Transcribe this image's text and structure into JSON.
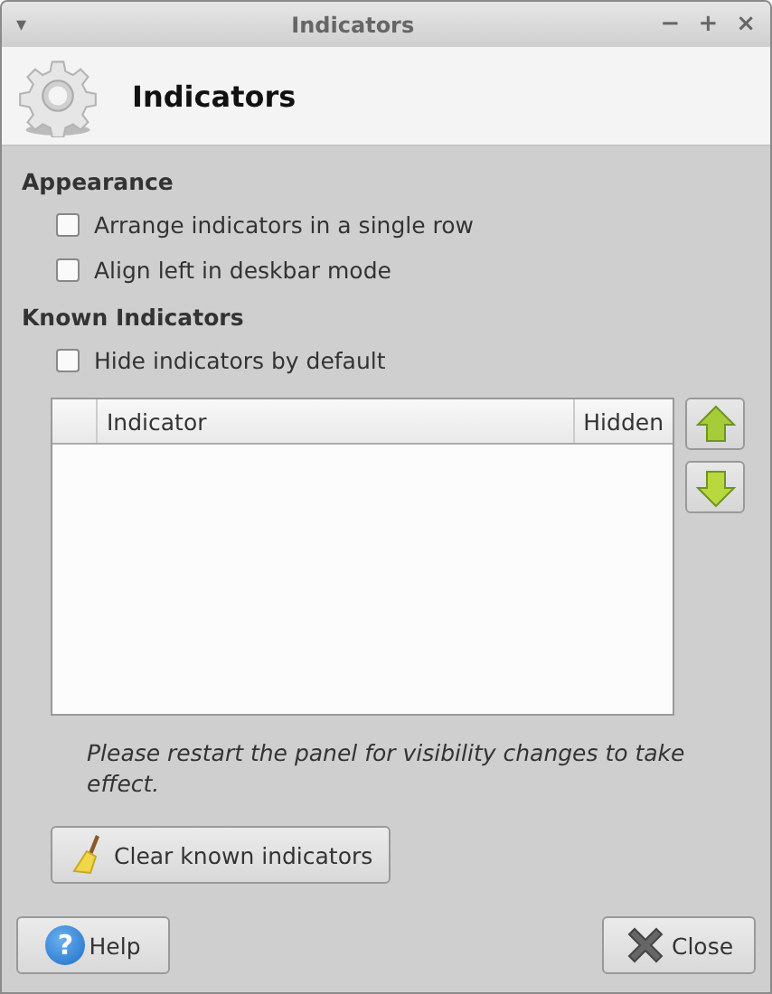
{
  "window": {
    "title": "Indicators",
    "menu_glyph": "▾",
    "controls": [
      "−",
      "+",
      "×"
    ]
  },
  "header": {
    "title": "Indicators"
  },
  "sections": [
    {
      "title": "Appearance",
      "options": [
        {
          "label": "Arrange indicators in a single row",
          "checked": false
        },
        {
          "label": "Align left in deskbar mode",
          "checked": false
        }
      ]
    },
    {
      "title": "Known Indicators",
      "options": [
        {
          "label": "Hide indicators by default",
          "checked": false
        }
      ]
    }
  ],
  "table": {
    "columns": [
      "",
      "Indicator",
      "Hidden"
    ]
  },
  "note": "Please restart the panel for visibility changes to take effect.",
  "clear_button": "Clear known indicators",
  "buttons": [
    {
      "kind": "help",
      "label": "Help",
      "glyph": "?"
    },
    {
      "kind": "close",
      "label": "Close"
    }
  ]
}
